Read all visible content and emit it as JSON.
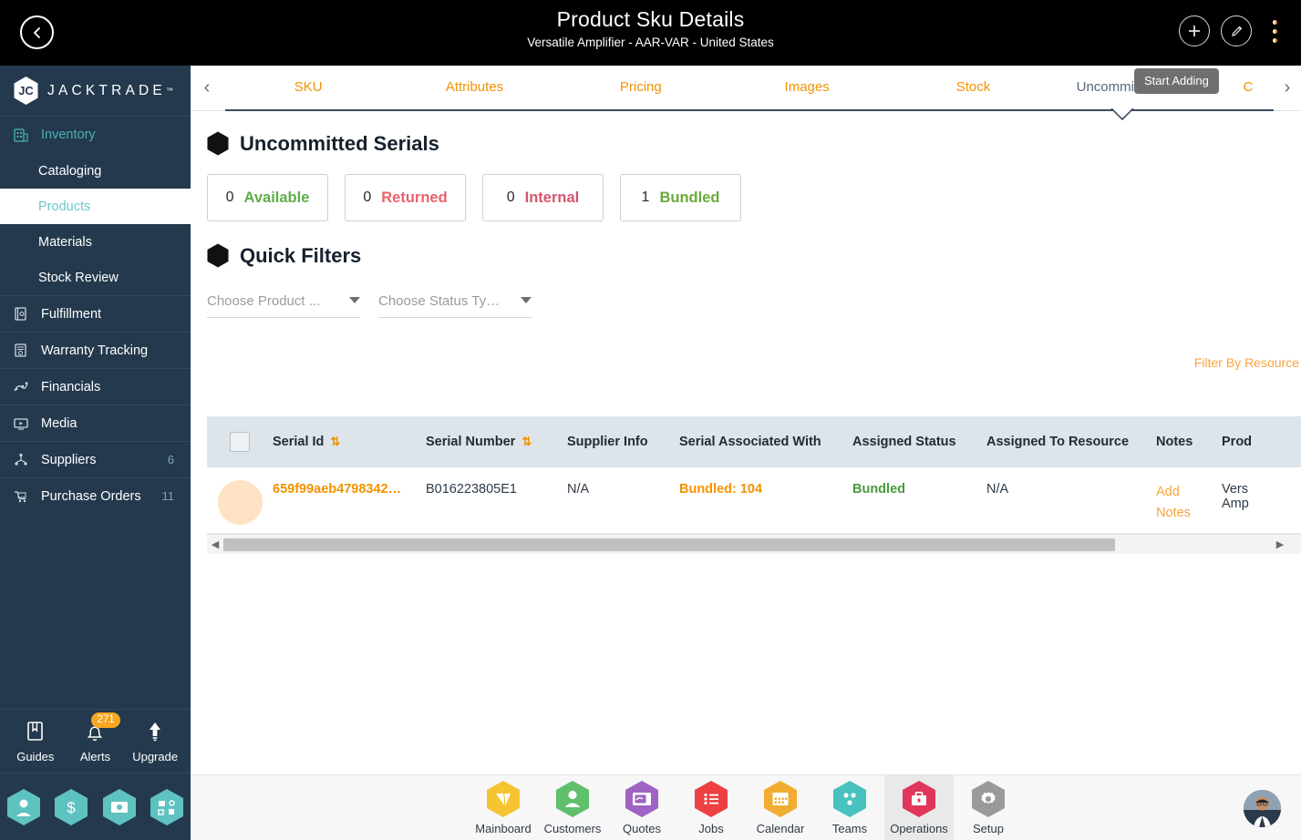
{
  "topbar": {
    "back_icon": "chevron-left-circle-icon",
    "title": "Product Sku Details",
    "subtitle": "Versatile Amplifier - AAR-VAR - United States",
    "add_icon": "plus-icon",
    "edit_icon": "pencil-icon",
    "more_icon": "kebab-menu-icon"
  },
  "sidebar": {
    "brand": "JACKTRADE",
    "brand_tm": "™",
    "items": [
      {
        "label": "Inventory",
        "icon": "inventory-icon",
        "type": "head",
        "count": ""
      },
      {
        "label": "Cataloging",
        "icon": "",
        "type": "sub",
        "count": ""
      },
      {
        "label": "Products",
        "icon": "",
        "type": "sub-active",
        "count": ""
      },
      {
        "label": "Materials",
        "icon": "",
        "type": "sub",
        "count": ""
      },
      {
        "label": "Stock Review",
        "icon": "",
        "type": "sub",
        "count": ""
      },
      {
        "label": "Fulfillment",
        "icon": "fulfillment-icon",
        "type": "item",
        "count": ""
      },
      {
        "label": "Warranty Tracking",
        "icon": "warranty-icon",
        "type": "item",
        "count": ""
      },
      {
        "label": "Financials",
        "icon": "financials-icon",
        "type": "item",
        "count": ""
      },
      {
        "label": "Media",
        "icon": "media-icon",
        "type": "item",
        "count": ""
      },
      {
        "label": "Suppliers",
        "icon": "suppliers-icon",
        "type": "item",
        "count": "6"
      },
      {
        "label": "Purchase Orders",
        "icon": "purchase-orders-icon",
        "type": "item",
        "count": "11"
      }
    ],
    "tools": [
      {
        "label": "Guides",
        "icon": "book-icon",
        "badge": ""
      },
      {
        "label": "Alerts",
        "icon": "bell-icon",
        "badge": "271"
      },
      {
        "label": "Upgrade",
        "icon": "up-arrow-icon",
        "badge": ""
      }
    ],
    "quick_hexes": [
      {
        "icon": "person-hex-icon"
      },
      {
        "icon": "dollar-hex-icon"
      },
      {
        "icon": "payment-hex-icon"
      },
      {
        "icon": "workflow-hex-icon"
      }
    ]
  },
  "tabs": {
    "prev_icon": "chevron-left-icon",
    "next_icon": "chevron-right-icon",
    "items": [
      {
        "label": "SKU",
        "active": false
      },
      {
        "label": "Attributes",
        "active": false
      },
      {
        "label": "Pricing",
        "active": false
      },
      {
        "label": "Images",
        "active": false
      },
      {
        "label": "Stock",
        "active": false
      },
      {
        "label": "Uncommitted Serials",
        "active": true
      },
      {
        "label": "C",
        "active": false
      }
    ],
    "tooltip": "Start Adding"
  },
  "main": {
    "section_title": "Uncommitted Serials",
    "stats": [
      {
        "num": "0",
        "label": "Available",
        "color": "#5eae4a"
      },
      {
        "num": "0",
        "label": "Returned",
        "color": "#e8616b"
      },
      {
        "num": "0",
        "label": "Internal",
        "color": "#d6536d"
      },
      {
        "num": "1",
        "label": "Bundled",
        "color": "#6aaa3a"
      }
    ],
    "quick_filters_title": "Quick Filters",
    "filters": [
      {
        "placeholder": "Choose Product ...",
        "value": ""
      },
      {
        "placeholder": "Choose Status Ty…",
        "value": ""
      }
    ],
    "filter_link": "Filter By Resource"
  },
  "table": {
    "columns": [
      {
        "label": "Serial Id",
        "sortable": true
      },
      {
        "label": "Serial Number",
        "sortable": true
      },
      {
        "label": "Supplier Info",
        "sortable": false
      },
      {
        "label": "Serial Associated With",
        "sortable": false
      },
      {
        "label": "Assigned Status",
        "sortable": false
      },
      {
        "label": "Assigned To Resource",
        "sortable": false
      },
      {
        "label": "Notes",
        "sortable": false
      },
      {
        "label": "Prod",
        "sortable": false
      }
    ],
    "sort_glyph": "⇅",
    "rows": [
      {
        "serial_id": "659f99aeb4798342…",
        "serial_number": "B016223805E1",
        "supplier_info": "N/A",
        "associated_with": "Bundled: 104",
        "assigned_status": "Bundled",
        "assigned_to_resource": "N/A",
        "notes_line1": "Add",
        "notes_line2": "Notes",
        "product_line1": "Vers",
        "product_line2": "Amp"
      }
    ]
  },
  "bottomnav": {
    "items": [
      {
        "label": "Mainboard",
        "icon": "mainboard-hex-icon",
        "color": "#f5c432",
        "active": false
      },
      {
        "label": "Customers",
        "icon": "customers-hex-icon",
        "color": "#5fbf6a",
        "active": false
      },
      {
        "label": "Quotes",
        "icon": "quotes-hex-icon",
        "color": "#a濾",
        "active": false
      },
      {
        "label": "Jobs",
        "icon": "jobs-hex-icon",
        "color": "#ed4040",
        "active": false
      },
      {
        "label": "Calendar",
        "icon": "calendar-hex-icon",
        "color": "#f0ad31",
        "active": false
      },
      {
        "label": "Teams",
        "icon": "teams-hex-icon",
        "color": "#48c2bf",
        "active": false
      },
      {
        "label": "Operations",
        "icon": "operations-hex-icon",
        "color": "#e0365c",
        "active": true
      },
      {
        "label": "Setup",
        "icon": "setup-hex-icon",
        "color": "#9a9a9a",
        "active": false
      }
    ],
    "avatar": "user-avatar"
  },
  "colors": {
    "accent_orange": "#f39200",
    "sidebar_bg": "#24394d",
    "teal": "#45b3b8",
    "table_header_bg": "#dde5ea"
  }
}
